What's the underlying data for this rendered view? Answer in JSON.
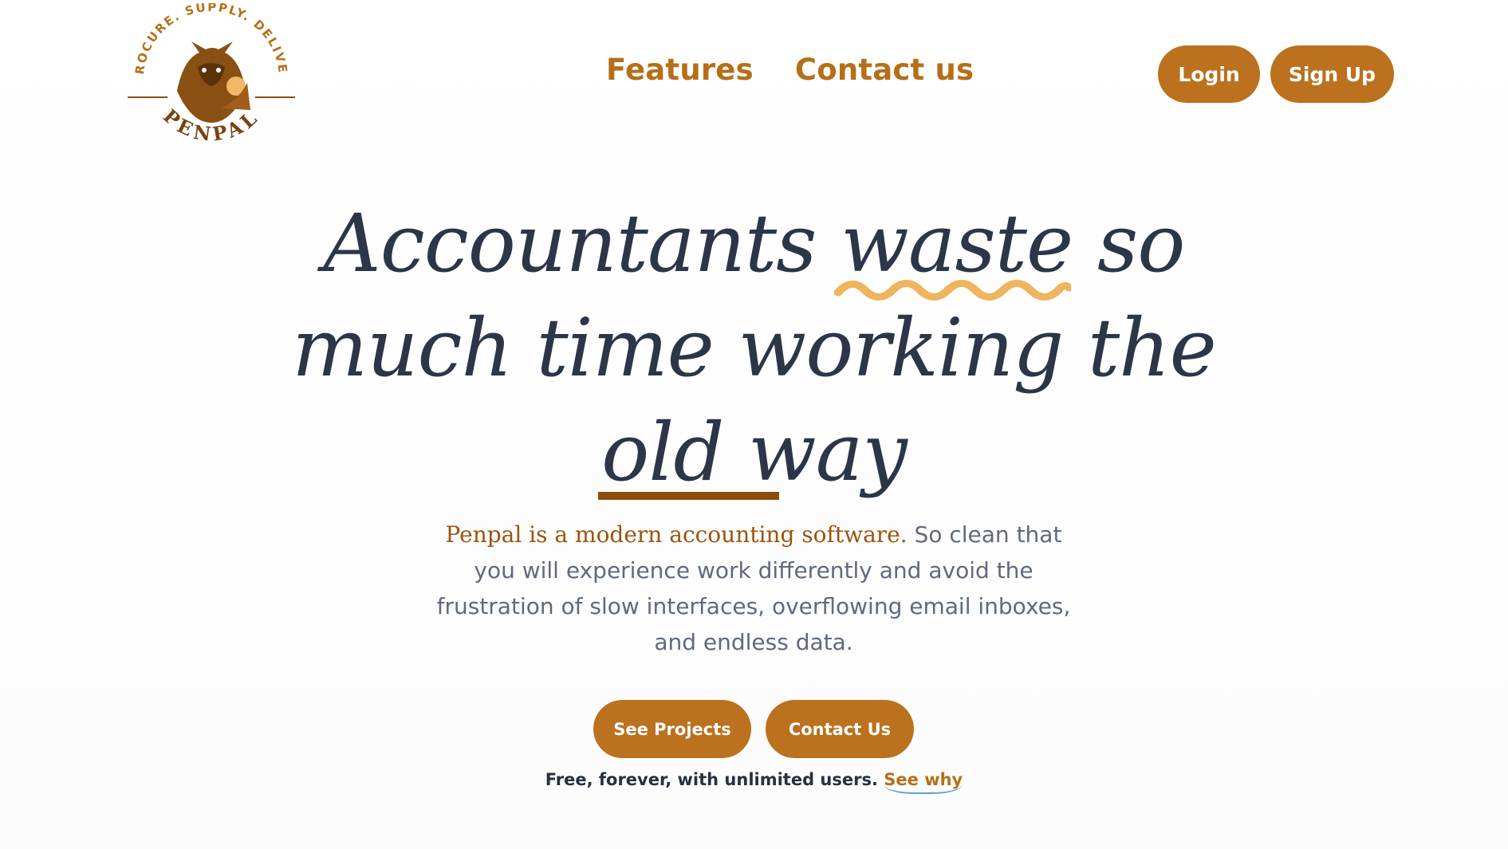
{
  "brand": {
    "name": "PENPAL",
    "tagline": "PROCURE. SUPPLY. DELIVER",
    "colors": {
      "accent": "#bb711d",
      "dark_accent": "#8e4b0b",
      "squiggle": "#efb45e",
      "heading": "#2b3648"
    }
  },
  "nav": {
    "items": [
      {
        "label": "Features"
      },
      {
        "label": "Contact us"
      }
    ]
  },
  "auth": {
    "login_label": "Login",
    "signup_label": "Sign Up"
  },
  "hero": {
    "line1_before": "Accountants ",
    "line1_mark": "waste",
    "line1_after": " so",
    "line2": "much time working the",
    "line3_mark": "old",
    "line3_after": " way",
    "sub_accent": "Penpal is a modern accounting software.",
    "sub_rest": " So clean that you will experience work differently and avoid the frustration of slow interfaces, overflowing email inboxes, and endless data."
  },
  "cta": {
    "projects_label": "See Projects",
    "contact_label": "Contact Us"
  },
  "footer_note": {
    "text": "Free, forever, with unlimited users.",
    "link": "See why"
  }
}
